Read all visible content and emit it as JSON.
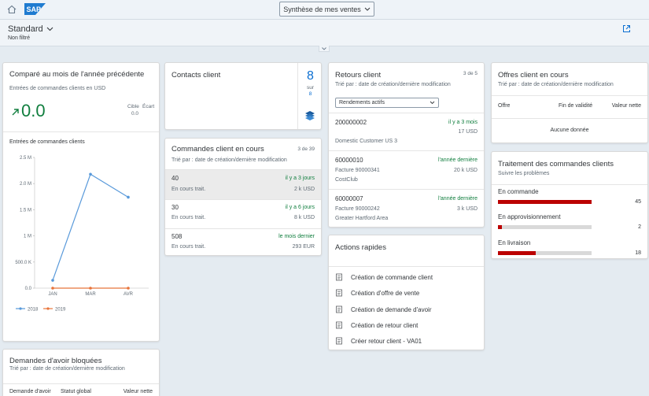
{
  "shell": {
    "title": "Synthèse de mes ventes",
    "logo_text": "SAP"
  },
  "header": {
    "variant": "Standard",
    "filter_status": "Non filtré"
  },
  "kpi_card": {
    "title": "Comparé au mois de l'année précédente",
    "subtitle": "Entrées de commandes clients en USD",
    "value": "0.0",
    "target_label": "Cible",
    "deviation_label": "Écart",
    "deviation_value": "0.0",
    "chart_title": "Entrées de commandes clients",
    "chart_data": {
      "type": "line",
      "x": [
        "JAN",
        "MAR",
        "AVR"
      ],
      "series": [
        {
          "name": "2018",
          "values": [
            150000,
            2180000,
            1740000
          ],
          "color": "#5899da"
        },
        {
          "name": "2019",
          "values": [
            0,
            0,
            0
          ],
          "color": "#e8743b"
        }
      ],
      "yticks": [
        "0.0",
        "500.0 K",
        "1 M",
        "1.5 M",
        "2.0 M",
        "2.5 M"
      ],
      "ylim": [
        0,
        2500000
      ],
      "legend_position": "bottom-left"
    }
  },
  "contacts_card": {
    "title": "Contacts client",
    "count": "8",
    "of_label": "sur",
    "total": "8"
  },
  "orders_card": {
    "title": "Commandes client en cours",
    "count": "3 de 39",
    "subtitle": "Trié par : date de création/dernière modification",
    "items": [
      {
        "id": "40",
        "status": "En cours trait.",
        "time": "il y a 3 jours",
        "amount": "2 k USD"
      },
      {
        "id": "30",
        "status": "En cours trait.",
        "time": "il y a 6 jours",
        "amount": "8 k USD"
      },
      {
        "id": "508",
        "status": "En cours trait.",
        "time": "le mois dernier",
        "amount": "293 EUR"
      }
    ]
  },
  "returns_card": {
    "title": "Retours client",
    "count": "3 de 5",
    "subtitle": "Trié par : date de création/dernière modification",
    "dropdown": "Rendements actifs",
    "items": [
      {
        "id": "200000002",
        "time": "il y a 3 mois",
        "amount": "17 USD",
        "line2": "Domestic Customer US 3",
        "line3": ""
      },
      {
        "id": "60000010",
        "time": "l'année dernière",
        "amount": "20 k USD",
        "line2": "Facture 90000341",
        "line3": "CostClub"
      },
      {
        "id": "60000007",
        "time": "l'année dernière",
        "amount": "3 k USD",
        "line2": "Facture 90000242",
        "line3": "Greater Hartford Area"
      }
    ]
  },
  "quick_actions": {
    "title": "Actions rapides",
    "items": [
      "Création de commande client",
      "Création d'offre de vente",
      "Création de demande d'avoir",
      "Création de retour client",
      "Créer retour client - VA01"
    ]
  },
  "offers_card": {
    "title": "Offres client en cours",
    "subtitle": "Trié par : date de création/dernière modification",
    "columns": [
      "Offre",
      "Fin de validité",
      "Valeur nette"
    ],
    "empty": "Aucune donnée"
  },
  "processing_card": {
    "title": "Traitement des commandes clients",
    "subtitle": "Suivre les problèmes",
    "items": [
      {
        "label": "En commande",
        "value": "45",
        "fraction": 1.0
      },
      {
        "label": "En approvisionnement",
        "value": "2",
        "fraction": 0.04
      },
      {
        "label": "En livraison",
        "value": "18",
        "fraction": 0.4
      }
    ],
    "bar_color": "#bb0000"
  },
  "credit_card": {
    "title": "Demandes d'avoir bloquées",
    "subtitle": "Trié par : date de création/dernière modification",
    "columns": [
      "Demande d'avoir",
      "Statut global",
      "Valeur nette"
    ]
  }
}
